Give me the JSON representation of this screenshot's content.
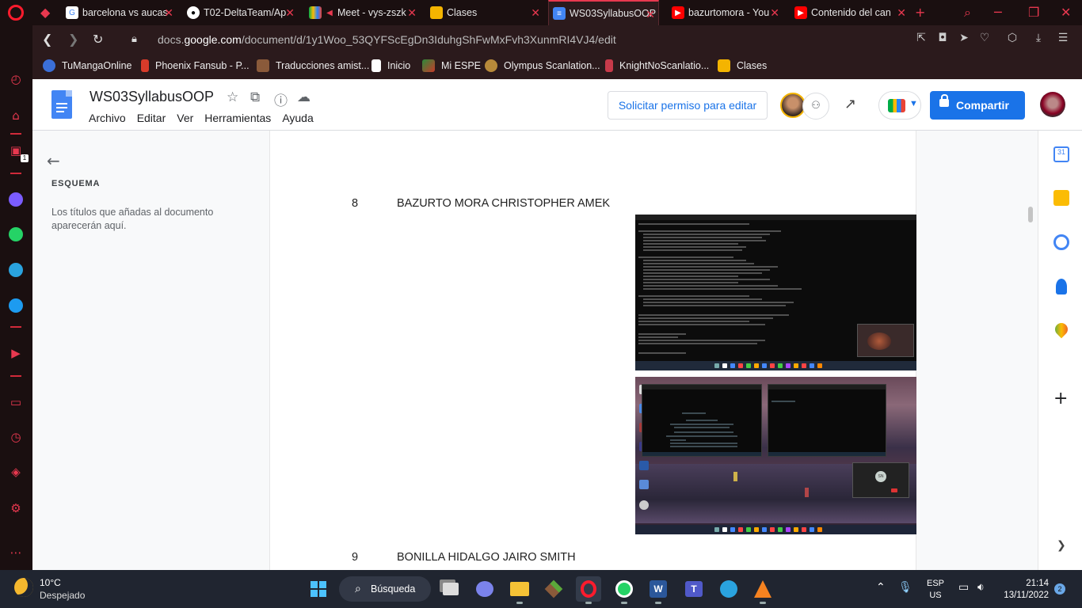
{
  "browser": {
    "tabs": [
      {
        "label": "barcelona vs aucas",
        "favicon": "google-icon"
      },
      {
        "label": "T02-DeltaTeam/Ap",
        "favicon": "github-icon"
      },
      {
        "label": "Meet - vys-zszk",
        "favicon": "meet-icon"
      },
      {
        "label": "Clases",
        "favicon": "classroom-icon"
      },
      {
        "label": "WS03SyllabusOOP",
        "favicon": "docs-icon",
        "active": true
      },
      {
        "label": "bazurtomora - You",
        "favicon": "youtube-icon"
      },
      {
        "label": "Contenido del can",
        "favicon": "youtube-icon"
      }
    ],
    "url_prefix": "docs.",
    "url_domain": "google.com",
    "url_path": "/document/d/1y1Woo_53QYFScEgDn3IduhgShFwMxFvh3XunmRI4VJ4/edit",
    "bookmarks": [
      {
        "label": "TuMangaOnline"
      },
      {
        "label": "Phoenix Fansub - P..."
      },
      {
        "label": "Traducciones amist..."
      },
      {
        "label": "Inicio"
      },
      {
        "label": "Mi ESPE"
      },
      {
        "label": "Olympus Scanlation..."
      },
      {
        "label": "KnightNoScanlatio..."
      },
      {
        "label": "Clases"
      }
    ],
    "sidebar_badge": "1"
  },
  "docs": {
    "title": "WS03SyllabusOOP",
    "menu": [
      "Archivo",
      "Editar",
      "Ver",
      "Herramientas",
      "Ayuda"
    ],
    "request_edit": "Solicitar permiso para editar",
    "share": "Compartir"
  },
  "outline": {
    "heading": "ESQUEMA",
    "empty_text": "Los títulos que añadas al documento aparecerán aquí."
  },
  "document": {
    "rows": [
      {
        "number": "8",
        "name": "BAZURTO MORA CHRISTOPHER AMEK"
      },
      {
        "number": "9",
        "name": "BONILLA HIDALGO JAIRO SMITH"
      }
    ]
  },
  "taskbar": {
    "temperature": "10°C",
    "weather": "Despejado",
    "search": "Búsqueda",
    "lang_top": "ESP",
    "lang_bottom": "US",
    "time": "21:14",
    "date": "13/11/2022",
    "notifications": "2"
  },
  "colors": {
    "accent": "#e8384f",
    "docs_blue": "#1a73e8"
  }
}
